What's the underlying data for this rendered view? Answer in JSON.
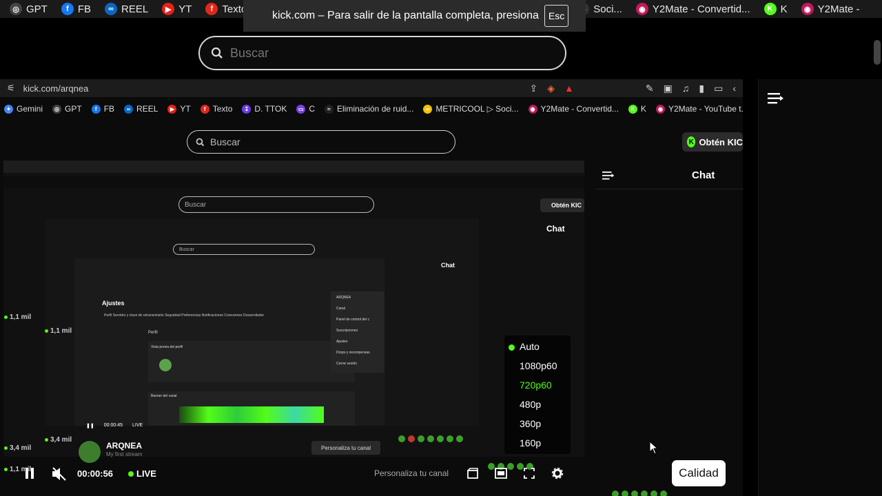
{
  "outer_bookmarks": [
    {
      "label": "GPT",
      "icon": "gpt-icon",
      "color": "#444444",
      "glyph": "◎"
    },
    {
      "label": "FB",
      "icon": "facebook-icon",
      "color": "#1877f2",
      "glyph": "f"
    },
    {
      "label": "REEL",
      "icon": "meta-icon",
      "color": "#0a66c2",
      "glyph": "∞"
    },
    {
      "label": "YT",
      "icon": "youtube-icon",
      "color": "#e62117",
      "glyph": "▶"
    },
    {
      "label": "Texto",
      "icon": "texto-icon",
      "color": "#e0281b",
      "glyph": "f"
    }
  ],
  "outer_bookmarks_right": [
    {
      "label": "Soci...",
      "icon": "metricool-icon",
      "color": "#333333",
      "glyph": "▷"
    },
    {
      "label": "Y2Mate - Convertid...",
      "icon": "y2mate-icon",
      "color": "#c2185b",
      "glyph": "◉"
    },
    {
      "label": "K",
      "icon": "kick-icon",
      "color": "#53fc18",
      "glyph": "K"
    },
    {
      "label": "Y2Mate - ",
      "icon": "y2mate-icon",
      "color": "#c2185b",
      "glyph": "◉"
    }
  ],
  "fullscreen_notice": {
    "text": "kick.com – Para salir de la pantalla completa, presiona",
    "key": "Esc"
  },
  "search": {
    "placeholder": "Buscar"
  },
  "inner": {
    "url": "kick.com/arqnea",
    "bookmarks": [
      {
        "label": "Gemini",
        "color": "#4285f4",
        "glyph": "✦"
      },
      {
        "label": "GPT",
        "color": "#444444",
        "glyph": "◎"
      },
      {
        "label": "FB",
        "color": "#1877f2",
        "glyph": "f"
      },
      {
        "label": "REEL",
        "color": "#0a66c2",
        "glyph": "∞"
      },
      {
        "label": "YT",
        "color": "#e62117",
        "glyph": "▶"
      },
      {
        "label": "Texto",
        "color": "#e0281b",
        "glyph": "f"
      },
      {
        "label": "D. TTOK",
        "color": "#6a3de8",
        "glyph": "↧"
      },
      {
        "label": "C",
        "color": "#7b3fe4",
        "glyph": "▭"
      },
      {
        "label": "Eliminación de ruid...",
        "color": "#222222",
        "glyph": "≈"
      },
      {
        "label": "METRICOOL ▷ Soci...",
        "color": "#f2c200",
        "glyph": "∞"
      },
      {
        "label": "Y2Mate - Convertid...",
        "color": "#c2185b",
        "glyph": "◉"
      },
      {
        "label": "K",
        "color": "#53fc18",
        "glyph": "K"
      },
      {
        "label": "Y2Mate - YouTube t...",
        "color": "#c2185b",
        "glyph": "◉"
      }
    ],
    "search_placeholder": "Buscar",
    "kick_button": "Obtén KIC",
    "chat_title": "Chat"
  },
  "nested": {
    "search": "Buscar",
    "kick_button": "Obtén KIC",
    "chat": "Chat",
    "ajustes": "Ajustes",
    "tabs": "Perfil  Servidor y clave de retransmisión  Seguridad  Preferencias  Notificaciones  Conexiones  Desarrollador",
    "perfil": "Perfil",
    "vista_previa": "Vista previa del perfil",
    "banner": "Banner del canal",
    "menu": [
      "ARQNEA",
      "Canal",
      "Panel de control del c",
      "Suscripciones",
      "Ajustes",
      "Drops y recompensas",
      "Cerrar sesión"
    ],
    "channel": "ARQNEA",
    "stream_title": "My first stream",
    "personaliza": "Personaliza tu canal",
    "time_small": "00:00:45",
    "live_small": "LIVE",
    "counts": [
      "1,1 mil",
      "1,1 mil",
      "3,4 mil",
      "3,4 mil",
      "1,1 mil"
    ]
  },
  "quality_menu": {
    "items": [
      "Auto",
      "1080p60",
      "720p60",
      "480p",
      "360p",
      "160p"
    ],
    "active": "720p60",
    "selected_dot": "Auto"
  },
  "player": {
    "time": "00:00:56",
    "live": "LIVE",
    "channel": "ARQNEA",
    "stream_title": "My first stream",
    "personaliza": "Personaliza tu canal"
  },
  "tooltip": "Calidad",
  "colors": {
    "accent": "#53fc18",
    "bg": "#000000"
  }
}
